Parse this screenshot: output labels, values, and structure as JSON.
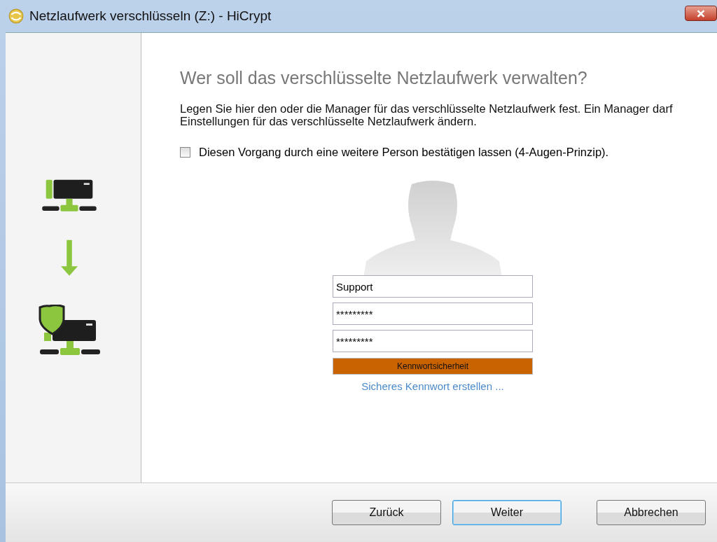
{
  "window": {
    "title": "Netzlaufwerk verschlüsseln (Z:) - HiCrypt"
  },
  "heading": "Wer soll das verschlüsselte Netzlaufwerk verwalten?",
  "description": "Legen Sie hier den oder die Manager für das verschlüsselte Netzlaufwerk fest. Ein Manager darf Einstellungen für das verschlüsselte Netzlaufwerk ändern.",
  "confirm_checkbox": {
    "label": "Diesen Vorgang durch eine weitere Person bestätigen lassen (4-Augen-Prinzip).",
    "checked": false
  },
  "fields": [
    {
      "value": "Support"
    },
    {
      "value": "*********"
    },
    {
      "value": "*********"
    }
  ],
  "strength_meter": {
    "label": "Kennwortsicherheit",
    "level": 1
  },
  "link": "Sicheres Kennwort erstellen ...",
  "buttons": [
    {
      "label": "Zurück",
      "focused": false
    },
    {
      "label": "Weiter",
      "focused": true
    },
    {
      "label": "Abbrechen",
      "focused": false
    }
  ]
}
